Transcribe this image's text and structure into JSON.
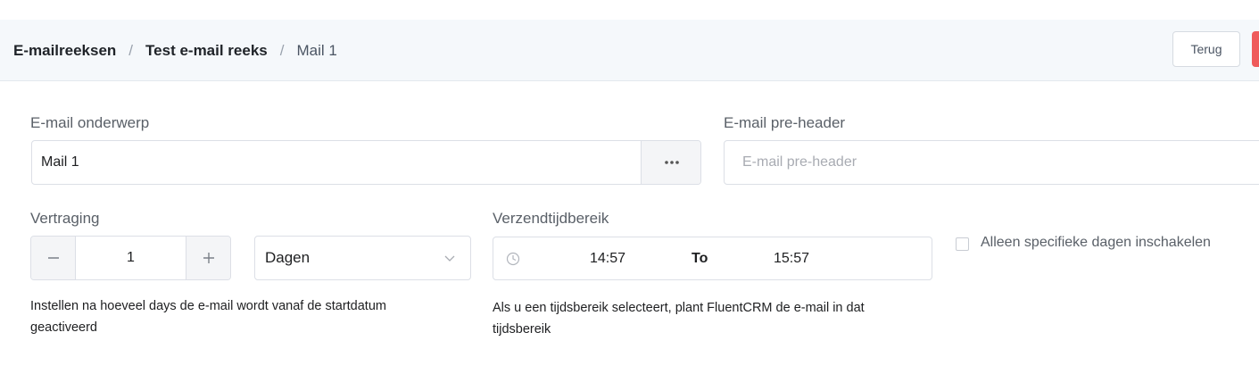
{
  "breadcrumb": {
    "items": [
      "E-mailreeksen",
      "Test e-mail reeks"
    ],
    "current": "Mail 1",
    "separator": "/"
  },
  "header": {
    "back_label": "Terug",
    "accent_color": "#ef5b5b"
  },
  "subject": {
    "label": "E-mail onderwerp",
    "value": "Mail 1",
    "more_icon": "ellipsis-icon"
  },
  "preheader": {
    "label": "E-mail pre-header",
    "value": "",
    "placeholder": "E-mail pre-header"
  },
  "delay": {
    "label": "Vertraging",
    "value": "1",
    "minus": "−",
    "plus": "+",
    "unit": "Dagen",
    "help": "Instellen na hoeveel days de e-mail wordt vanaf de startdatum geactiveerd"
  },
  "send_window": {
    "label": "Verzendtijdbereik",
    "start": "14:57",
    "separator": "To",
    "end": "15:57",
    "help": "Als u een tijdsbereik selecteert, plant FluentCRM de e-mail in dat tijdsbereik"
  },
  "specific_days": {
    "label": "Alleen specifieke dagen inschakelen",
    "checked": false
  }
}
